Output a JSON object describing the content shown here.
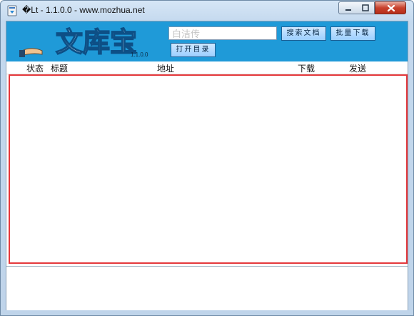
{
  "window": {
    "title": "�Lt - 1.1.0.0 - www.mozhua.net",
    "icon": "app-icon"
  },
  "colors": {
    "banner": "#1f9ad8",
    "list_border": "#e5393c",
    "button_bg": "#b8dcff"
  },
  "banner": {
    "logo_text": "文库宝",
    "version": "1.1.0.0",
    "search_value": "白洁传",
    "buttons": [
      "搜索文档",
      "批量下载",
      "打开目录"
    ]
  },
  "table": {
    "columns": [
      "状态",
      "标题",
      "地址",
      "下载",
      "发送"
    ],
    "rows": []
  }
}
